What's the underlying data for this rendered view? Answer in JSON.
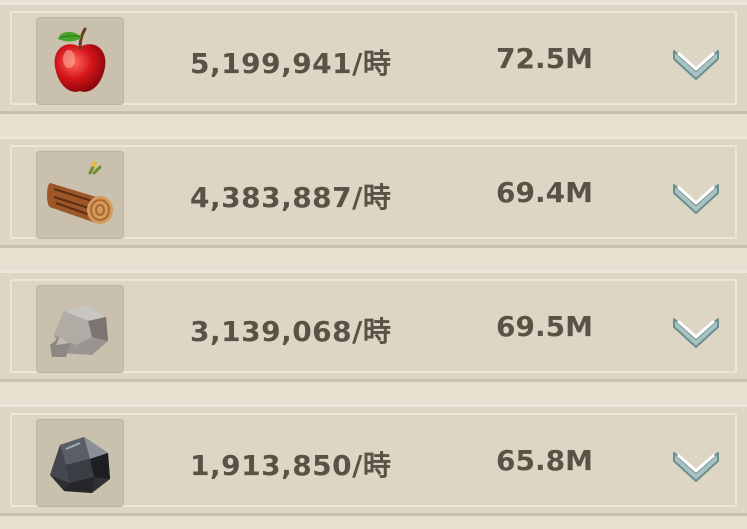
{
  "resources": [
    {
      "icon": "apple-icon",
      "rate": "5,199,941/時",
      "total": "72.5M"
    },
    {
      "icon": "wood-log-icon",
      "rate": "4,383,887/時",
      "total": "69.4M"
    },
    {
      "icon": "stone-icon",
      "rate": "3,139,068/時",
      "total": "69.5M"
    },
    {
      "icon": "iron-ore-icon",
      "rate": "1,913,850/時",
      "total": "65.8M"
    }
  ],
  "colors": {
    "background": "#e6e0d0",
    "row": "#ddd6c4",
    "text": "#5a5246"
  }
}
